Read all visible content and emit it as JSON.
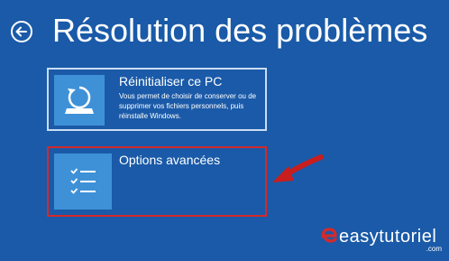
{
  "header": {
    "title": "Résolution des problèmes"
  },
  "tiles": [
    {
      "title": "Réinitialiser ce PC",
      "description": "Vous permet de choisir de conserver ou de supprimer vos fichiers personnels, puis réinstalle Windows.",
      "icon": "reset-pc-icon"
    },
    {
      "title": "Options avancées",
      "description": "",
      "icon": "checklist-icon"
    }
  ],
  "watermark": {
    "logo_letter": "e",
    "name": "easytutoriel",
    "domain": ".com"
  },
  "colors": {
    "background": "#1a5aa8",
    "tile_icon": "#3f91d7",
    "highlight": "#d42a2a",
    "text": "#ffffff"
  }
}
